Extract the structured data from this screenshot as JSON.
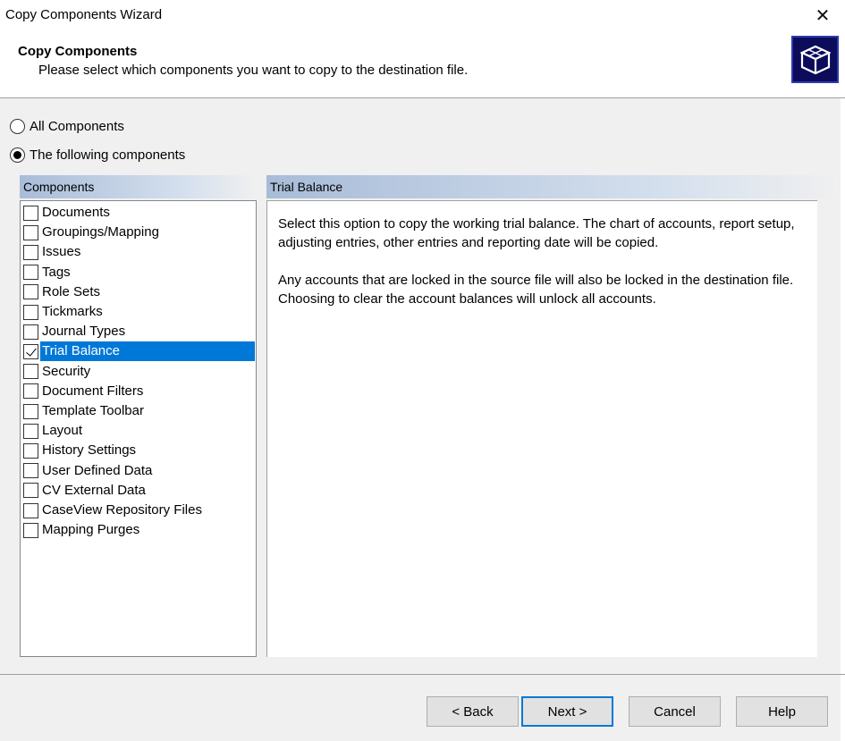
{
  "window": {
    "title": "Copy Components Wizard",
    "close_glyph": "✕"
  },
  "header": {
    "title": "Copy Components",
    "subtitle": "Please select which components you want to copy to the destination file.",
    "logo_icon": "box-icon"
  },
  "options": {
    "all_label": "All Components",
    "following_label": "The following components",
    "selected": "following"
  },
  "components_panel": {
    "header": "Components",
    "items": [
      {
        "label": "Documents",
        "checked": false,
        "selected": false
      },
      {
        "label": "Groupings/Mapping",
        "checked": false,
        "selected": false
      },
      {
        "label": "Issues",
        "checked": false,
        "selected": false
      },
      {
        "label": "Tags",
        "checked": false,
        "selected": false
      },
      {
        "label": "Role Sets",
        "checked": false,
        "selected": false
      },
      {
        "label": "Tickmarks",
        "checked": false,
        "selected": false
      },
      {
        "label": "Journal Types",
        "checked": false,
        "selected": false
      },
      {
        "label": "Trial Balance",
        "checked": true,
        "selected": true
      },
      {
        "label": "Security",
        "checked": false,
        "selected": false
      },
      {
        "label": "Document Filters",
        "checked": false,
        "selected": false
      },
      {
        "label": "Template Toolbar",
        "checked": false,
        "selected": false
      },
      {
        "label": "Layout",
        "checked": false,
        "selected": false
      },
      {
        "label": "History Settings",
        "checked": false,
        "selected": false
      },
      {
        "label": "User Defined Data",
        "checked": false,
        "selected": false
      },
      {
        "label": "CV External Data",
        "checked": false,
        "selected": false
      },
      {
        "label": "CaseView Repository Files",
        "checked": false,
        "selected": false
      },
      {
        "label": "Mapping Purges",
        "checked": false,
        "selected": false
      }
    ]
  },
  "details_panel": {
    "header": "Trial Balance",
    "paragraph1": "Select this option to copy the working trial balance. The chart of accounts, report setup, adjusting entries, other entries and reporting date will be copied.",
    "paragraph2": "Any accounts that are locked in the source file will also be locked in the destination file. Choosing to clear the account balances will unlock all accounts."
  },
  "buttons": {
    "back": "< Back",
    "next": "Next >",
    "cancel": "Cancel",
    "help": "Help"
  },
  "colors": {
    "selection": "#0078d7",
    "logo_bg": "#0c0c5a",
    "panel_header_start": "#a8bcd8"
  }
}
